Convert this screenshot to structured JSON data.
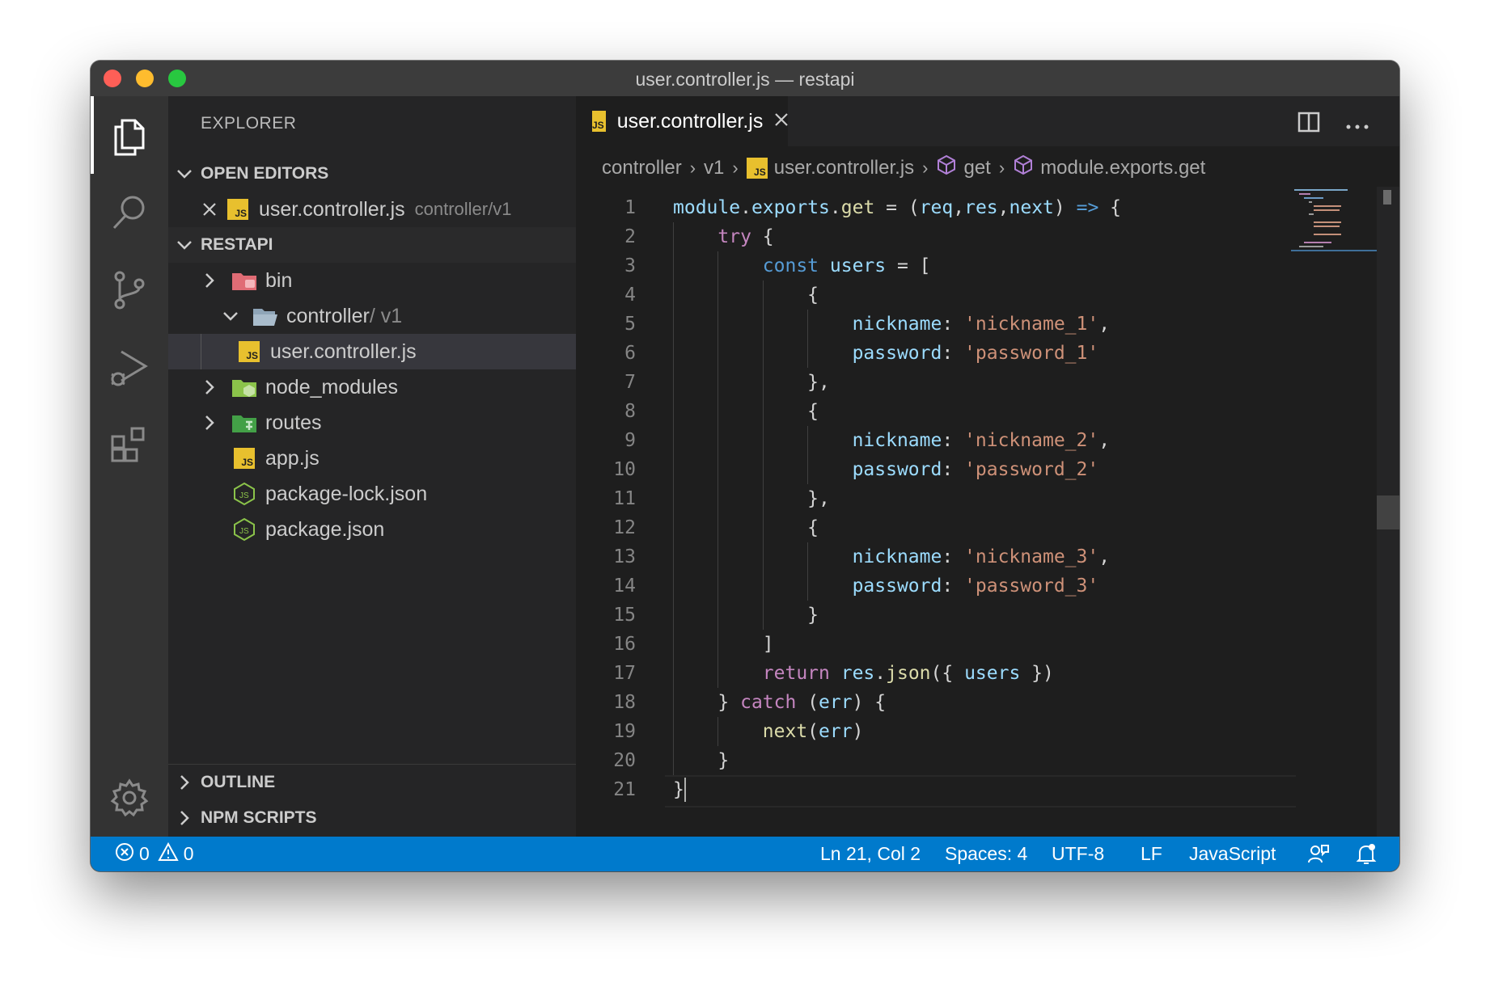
{
  "window": {
    "title": "user.controller.js — restapi"
  },
  "sidebar": {
    "title": "EXPLORER",
    "open_editors": {
      "header": "OPEN EDITORS",
      "items": [
        {
          "name": "user.controller.js",
          "path": "controller/v1"
        }
      ]
    },
    "project": {
      "header": "RESTAPI",
      "tree": [
        {
          "name": "bin",
          "type": "folder"
        },
        {
          "name": "controller",
          "suffix": " / v1",
          "type": "folder-open"
        },
        {
          "name": "user.controller.js",
          "type": "js"
        },
        {
          "name": "node_modules",
          "type": "folder"
        },
        {
          "name": "routes",
          "type": "folder"
        },
        {
          "name": "app.js",
          "type": "js"
        },
        {
          "name": "package-lock.json",
          "type": "node"
        },
        {
          "name": "package.json",
          "type": "node"
        }
      ]
    },
    "outline": "OUTLINE",
    "npm_scripts": "NPM SCRIPTS"
  },
  "editor": {
    "tab": {
      "label": "user.controller.js"
    },
    "breadcrumb": [
      "controller",
      "v1",
      "user.controller.js",
      "get",
      "module.exports.get"
    ],
    "lines": [
      "module.exports.get = (req,res,next) => {",
      "    try {",
      "        const users = [",
      "            {",
      "                nickname: 'nickname_1',",
      "                password: 'password_1'",
      "            },",
      "            {",
      "                nickname: 'nickname_2',",
      "                password: 'password_2'",
      "            },",
      "            {",
      "                nickname: 'nickname_3',",
      "                password: 'password_3'",
      "            }",
      "        ]",
      "        return res.json({ users })",
      "    } catch (err) {",
      "        next(err)",
      "    }",
      "}"
    ]
  },
  "statusbar": {
    "errors": "0",
    "warnings": "0",
    "position": "Ln 21, Col 2",
    "spaces": "Spaces: 4",
    "encoding": "UTF-8",
    "eol": "LF",
    "language": "JavaScript"
  },
  "colors": {
    "statusbar": "#007acc",
    "sidebar": "#252526",
    "editor": "#1e1e1e",
    "activitybar": "#333333"
  }
}
